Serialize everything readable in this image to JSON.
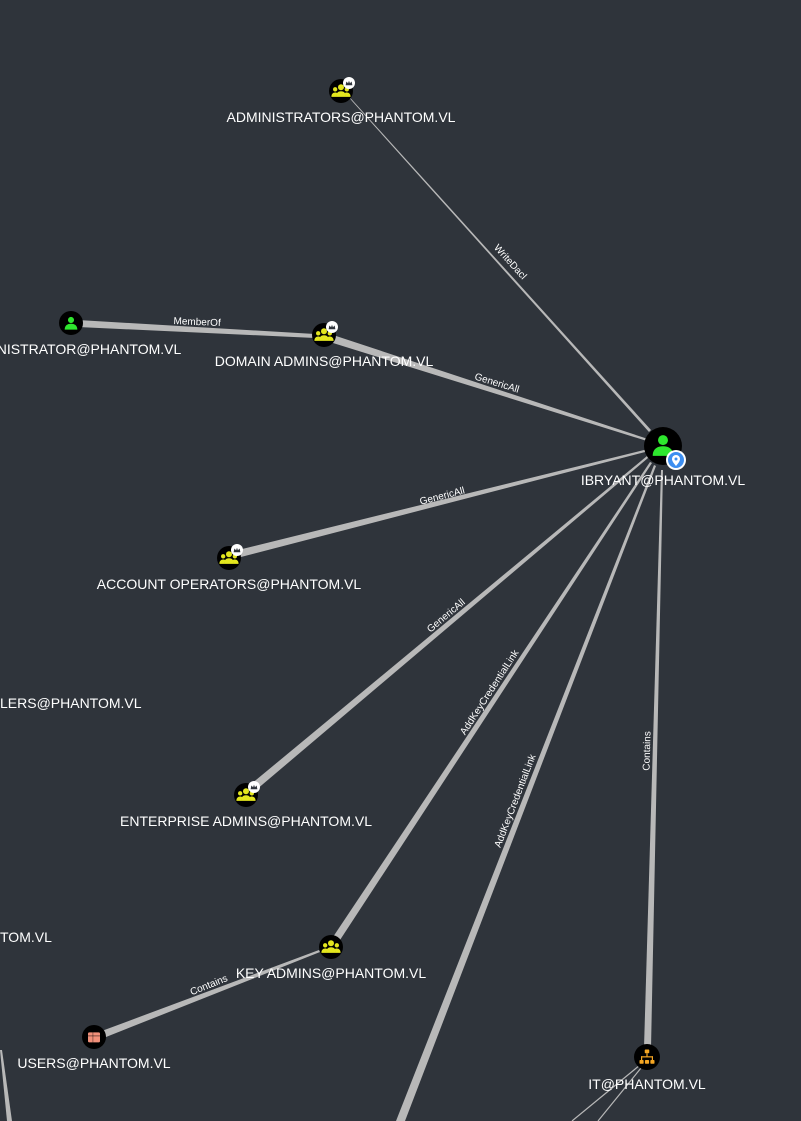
{
  "colors": {
    "background": "#2f343b",
    "edge": "#b8b8b8",
    "user_icon": "#2ee62e",
    "group_icon": "#e3e61e",
    "ou_icon": "#f5a623",
    "container_icon": "#f0907a",
    "marker": "#3d8ef0"
  },
  "nodes": {
    "administrators": {
      "label": "ADMINISTRATORS@PHANTOM.VL",
      "icon": "group-icon"
    },
    "administrator_user": {
      "label": "NISTRATOR@PHANTOM.VL",
      "icon": "user-icon"
    },
    "domain_admins": {
      "label": "DOMAIN ADMINS@PHANTOM.VL",
      "icon": "group-icon"
    },
    "ibryant": {
      "label": "IBRYANT@PHANTOM.VL",
      "icon": "user-icon"
    },
    "account_operators": {
      "label": "ACCOUNT OPERATORS@PHANTOM.VL",
      "icon": "group-icon"
    },
    "controllers_partial": {
      "label": "LERS@PHANTOM.VL"
    },
    "enterprise_admins": {
      "label": "ENTERPRISE ADMINS@PHANTOM.VL",
      "icon": "group-icon"
    },
    "tom_partial": {
      "label": "TOM.VL"
    },
    "key_admins": {
      "label": "KEY ADMINS@PHANTOM.VL",
      "icon": "group-icon"
    },
    "users": {
      "label": "USERS@PHANTOM.VL",
      "icon": "container-icon"
    },
    "it": {
      "label": "IT@PHANTOM.VL",
      "icon": "ou-icon"
    }
  },
  "edges": {
    "writedacl": "WriteDacl",
    "memberof": "MemberOf",
    "genericall_domain_admins": "GenericAll",
    "genericall_account_operators": "GenericAll",
    "genericall_enterprise_admins": "GenericAll",
    "addkeycredentiallink_key_admins": "AddKeyCredentialLink",
    "addkeycredentiallink_offscreen": "AddKeyCredentialLink",
    "contains_it": "Contains",
    "contains_users": "Contains"
  }
}
